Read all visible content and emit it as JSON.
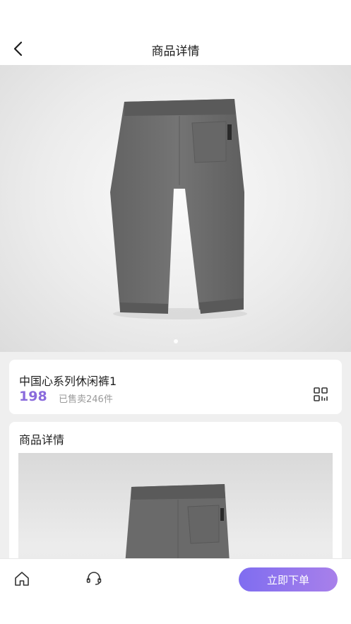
{
  "header": {
    "title": "商品详情",
    "back_icon": "chevron-left-icon"
  },
  "product": {
    "name": "中国心系列休闲裤1",
    "price": "198",
    "sold": "已售卖246件",
    "image_count": 1,
    "active_image": 1
  },
  "detail": {
    "title": "商品详情"
  },
  "bottom_bar": {
    "home_icon": "home-icon",
    "service_icon": "headset-icon",
    "order_label": "立即下单"
  },
  "colors": {
    "accent": "#8a6bdc",
    "button_gradient_start": "#7f6df0",
    "button_gradient_end": "#a880ea",
    "background": "#efefef",
    "pants": "#6b6b6b"
  }
}
